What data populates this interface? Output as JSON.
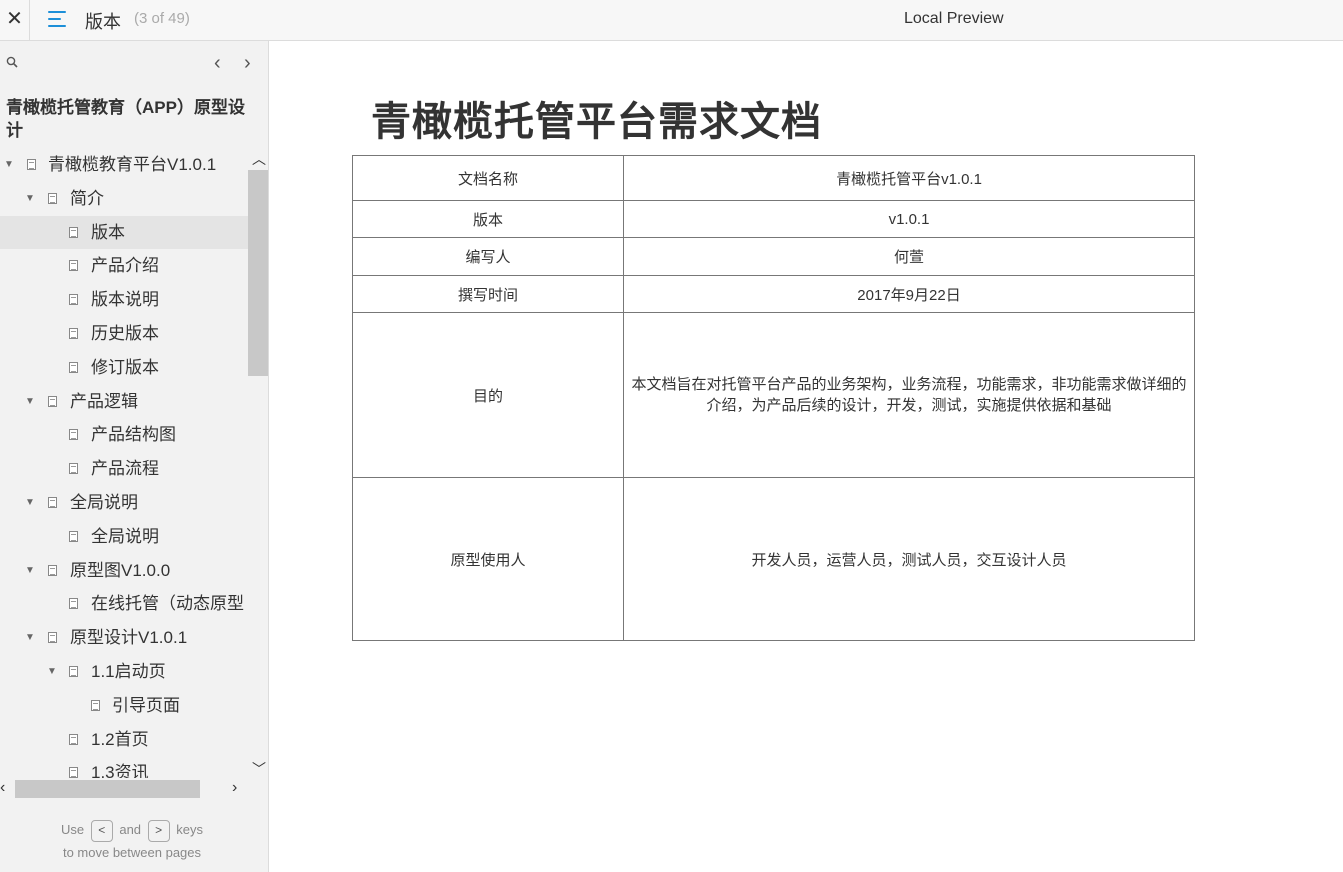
{
  "topbar": {
    "close_icon": "close-icon",
    "page_name": "版本",
    "page_count": "(3 of 49)",
    "title": "Local Preview"
  },
  "sidebar": {
    "project_title": "青橄榄托管教育（APP）原型设计",
    "tree": [
      {
        "label": "青橄榄教育平台V1.0.1",
        "level": 0,
        "expanded": true
      },
      {
        "label": "简介",
        "level": 1,
        "expanded": true
      },
      {
        "label": "版本",
        "level": 2,
        "selected": true
      },
      {
        "label": "产品介绍",
        "level": 2
      },
      {
        "label": "版本说明",
        "level": 2
      },
      {
        "label": "历史版本",
        "level": 2
      },
      {
        "label": "修订版本",
        "level": 2
      },
      {
        "label": "产品逻辑",
        "level": 1,
        "expanded": true
      },
      {
        "label": "产品结构图",
        "level": 2
      },
      {
        "label": "产品流程",
        "level": 2
      },
      {
        "label": "全局说明",
        "level": 1,
        "expanded": true
      },
      {
        "label": "全局说明",
        "level": 2
      },
      {
        "label": "原型图V1.0.0",
        "level": 1,
        "expanded": true
      },
      {
        "label": "在线托管（动态原型",
        "level": 2
      },
      {
        "label": "原型设计V1.0.1",
        "level": 1,
        "expanded": true
      },
      {
        "label": "1.1启动页",
        "level": 2,
        "expanded": true
      },
      {
        "label": "引导页面",
        "level": 3
      },
      {
        "label": "1.2首页",
        "level": 2
      },
      {
        "label": "1.3资讯",
        "level": 2
      }
    ],
    "hint": {
      "use": "Use",
      "key_prev": "<",
      "and": "and",
      "key_next": ">",
      "keys": "keys",
      "line2": "to move between pages"
    }
  },
  "main": {
    "doc_title": "青橄榄托管平台需求文档",
    "rows": [
      {
        "key": "文档名称",
        "value": "青橄榄托管平台v1.0.1"
      },
      {
        "key": "版本",
        "value": "v1.0.1"
      },
      {
        "key": "编写人",
        "value": "何萱"
      },
      {
        "key": "撰写时间",
        "value": "2017年9月22日"
      },
      {
        "key": "目的",
        "value": "本文档旨在对托管平台产品的业务架构，业务流程，功能需求，非功能需求做详细的介绍，为产品后续的设计，开发，测试，实施提供依据和基础"
      },
      {
        "key": "原型使用人",
        "value": "开发人员，运营人员，测试人员，交互设计人员"
      }
    ]
  }
}
